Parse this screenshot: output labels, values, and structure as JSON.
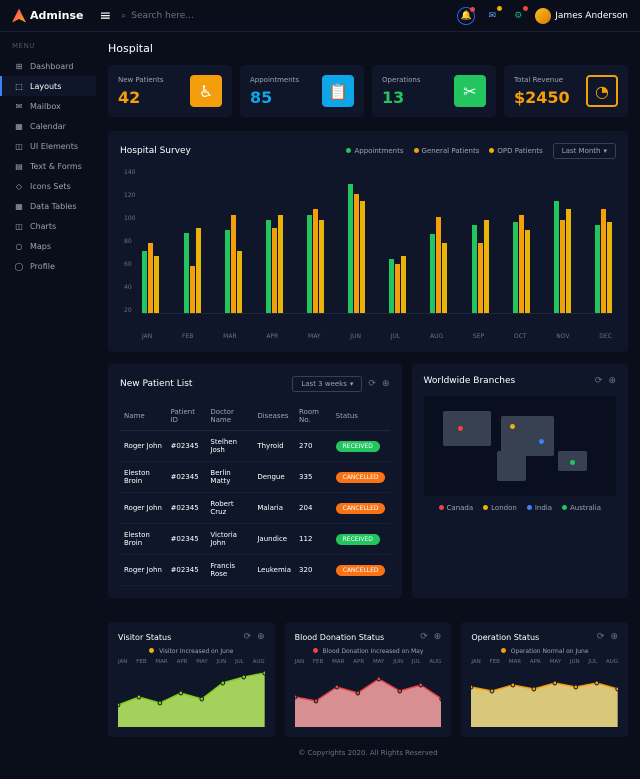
{
  "brand": "Adminse",
  "search": {
    "placeholder": "Search here..."
  },
  "user": {
    "name": "James Anderson"
  },
  "menu": {
    "header": "MENU",
    "items": [
      {
        "label": "Dashboard",
        "icon": "⊞"
      },
      {
        "label": "Layouts",
        "icon": "⬚",
        "active": true
      },
      {
        "label": "Mailbox",
        "icon": "✉"
      },
      {
        "label": "Calendar",
        "icon": "▦"
      },
      {
        "label": "UI Elements",
        "icon": "◫"
      },
      {
        "label": "Text & Forms",
        "icon": "▤"
      },
      {
        "label": "Icons Sets",
        "icon": "◇"
      },
      {
        "label": "Data Tables",
        "icon": "▦"
      },
      {
        "label": "Charts",
        "icon": "◫"
      },
      {
        "label": "Maps",
        "icon": "○"
      },
      {
        "label": "Profile",
        "icon": "◯"
      }
    ]
  },
  "page_title": "Hospital",
  "cards": [
    {
      "title": "New Patients",
      "value": "42",
      "color": "#f59e0b"
    },
    {
      "title": "Appointments",
      "value": "85",
      "color": "#0ea5e9"
    },
    {
      "title": "Operations",
      "value": "13",
      "color": "#22c55e"
    },
    {
      "title": "Total Revenue",
      "value": "$2450",
      "color": "#f59e0b"
    }
  ],
  "survey": {
    "title": "Hospital Survey",
    "legend": [
      "Appointments",
      "General Patients",
      "OPD Patients"
    ],
    "dropdown": "Last Month"
  },
  "chart_data": {
    "type": "bar",
    "title": "Hospital Survey",
    "xlabel": "",
    "ylabel": "",
    "ylim": [
      0,
      140
    ],
    "yticks": [
      20,
      40,
      60,
      80,
      100,
      120,
      140
    ],
    "categories": [
      "JAN",
      "FEB",
      "MAR",
      "APR",
      "MAY",
      "JUN",
      "JUL",
      "AUG",
      "SEP",
      "OCT",
      "NOV",
      "DEC"
    ],
    "series": [
      {
        "name": "Appointments",
        "color": "#22c55e",
        "values": [
          60,
          77,
          80,
          90,
          95,
          125,
          52,
          76,
          85,
          88,
          108,
          85
        ]
      },
      {
        "name": "General Patients",
        "color": "#f59e0b",
        "values": [
          68,
          45,
          95,
          82,
          100,
          115,
          47,
          93,
          68,
          95,
          90,
          100
        ]
      },
      {
        "name": "OPD Patients",
        "color": "#eab308",
        "values": [
          55,
          82,
          60,
          95,
          90,
          108,
          55,
          68,
          90,
          80,
          100,
          88
        ]
      }
    ]
  },
  "patients": {
    "title": "New Patient List",
    "dropdown": "Last 3 weeks",
    "columns": [
      "Name",
      "Patient ID",
      "Doctor Name",
      "Diseases",
      "Room No.",
      "Status"
    ],
    "rows": [
      {
        "name": "Roger John",
        "id": "#02345",
        "doctor": "Stelhen Josh",
        "disease": "Thyroid",
        "room": "270",
        "status": "RECEIVED",
        "badge": "g"
      },
      {
        "name": "Eleston Broin",
        "id": "#02345",
        "doctor": "Berlin Matty",
        "disease": "Dengue",
        "room": "335",
        "status": "CANCELLED",
        "badge": "o"
      },
      {
        "name": "Roger John",
        "id": "#02345",
        "doctor": "Robert Cruz",
        "disease": "Malaria",
        "room": "204",
        "status": "CANCELLED",
        "badge": "o"
      },
      {
        "name": "Eleston Broin",
        "id": "#02345",
        "doctor": "Victoria John",
        "disease": "Jaundice",
        "room": "112",
        "status": "RECEIVED",
        "badge": "g"
      },
      {
        "name": "Roger John",
        "id": "#02345",
        "doctor": "Francis Rose",
        "disease": "Leukemia",
        "room": "320",
        "status": "CANCELLED",
        "badge": "o"
      }
    ]
  },
  "branches": {
    "title": "Worldwide Branches",
    "legend": [
      {
        "label": "Canada",
        "color": "#ef4444"
      },
      {
        "label": "London",
        "color": "#eab308"
      },
      {
        "label": "India",
        "color": "#3b82f6"
      },
      {
        "label": "Australia",
        "color": "#22c55e"
      }
    ]
  },
  "minis": [
    {
      "title": "Visitor Status",
      "legend": "Visitor Increased on June",
      "dot": "#eab308",
      "color": "#bef264",
      "stroke": "#84cc16",
      "months": [
        "JAN",
        "FEB",
        "MAR",
        "APR",
        "MAY",
        "JUN",
        "JUL",
        "AUG"
      ],
      "values": [
        22,
        30,
        24,
        34,
        28,
        44,
        50,
        54
      ]
    },
    {
      "title": "Blood Donation Status",
      "legend": "Blood Donation Increased on May",
      "dot": "#ef4444",
      "color": "#fca5a5",
      "stroke": "#ef4444",
      "months": [
        "JAN",
        "FEB",
        "MAR",
        "APR",
        "MAY",
        "JUN",
        "JUL",
        "AUG"
      ],
      "values": [
        30,
        26,
        40,
        34,
        48,
        36,
        42,
        28
      ]
    },
    {
      "title": "Operation Status",
      "legend": "Operation Normal on June",
      "dot": "#f59e0b",
      "color": "#fde68a",
      "stroke": "#f59e0b",
      "months": [
        "JAN",
        "FEB",
        "MAR",
        "APR",
        "MAY",
        "JUN",
        "JUL",
        "AUG"
      ],
      "values": [
        40,
        36,
        42,
        38,
        44,
        40,
        44,
        38
      ]
    }
  ],
  "footer": "© Copyrights 2020. All Rights Reserved"
}
